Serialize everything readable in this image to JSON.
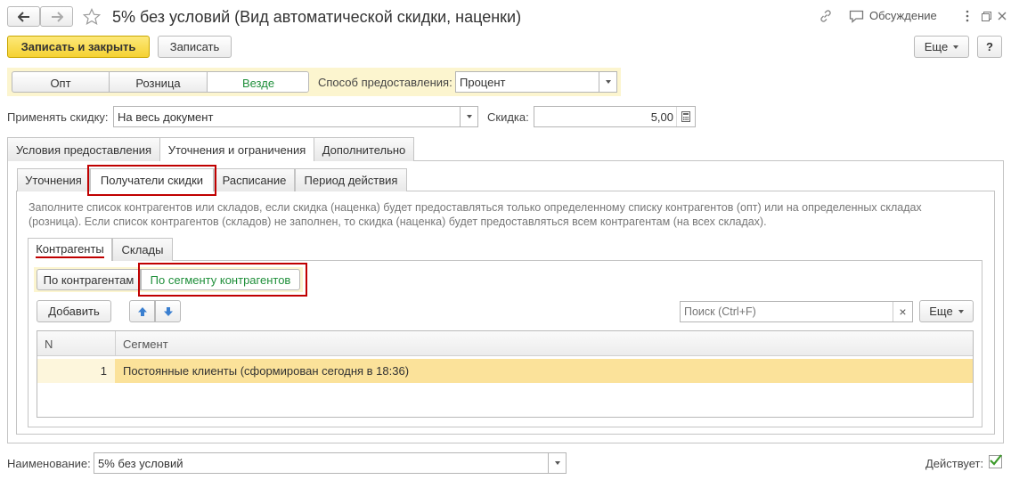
{
  "window": {
    "title": "5% без условий (Вид автоматической скидки, наценки)",
    "discussion_label": "Обсуждение"
  },
  "toolbar": {
    "save_close_label": "Записать и закрыть",
    "save_label": "Записать",
    "more_label": "Еще",
    "help_label": "?"
  },
  "scope": {
    "options": [
      "Опт",
      "Розница",
      "Везде"
    ],
    "selected": "Везде",
    "method_label": "Способ предоставления:",
    "method_value": "Процент"
  },
  "apply": {
    "label": "Применять скидку:",
    "value": "На весь документ",
    "discount_label": "Скидка:",
    "discount_value": "5,00"
  },
  "main_tabs": [
    {
      "label": "Условия предоставления",
      "active": false
    },
    {
      "label": "Уточнения и ограничения",
      "active": true
    },
    {
      "label": "Дополнительно",
      "active": false
    }
  ],
  "sub_tabs": [
    {
      "label": "Уточнения",
      "active": false
    },
    {
      "label": "Получатели скидки",
      "active": true
    },
    {
      "label": "Расписание",
      "active": false
    },
    {
      "label": "Период действия",
      "active": false
    }
  ],
  "info_text_1": "Заполните список контрагентов или складов, если скидка (наценка) будет предоставляться только определенному списку контрагентов (опт) или на определенных складах",
  "info_text_2": "(розница). Если список контрагентов (складов) не заполнен, то скидка (наценка) будет предоставляться всем контрагентам (на всех складах).",
  "inner_tabs": [
    {
      "label": "Контрагенты",
      "active": true
    },
    {
      "label": "Склады",
      "active": false
    }
  ],
  "mode": {
    "by_counterparties": "По контрагентам",
    "by_segment": "По сегменту контрагентов",
    "selected": "По сегменту контрагентов"
  },
  "list_toolbar": {
    "add_label": "Добавить",
    "search_placeholder": "Поиск (Ctrl+F)",
    "clear_symbol": "×",
    "more_label": "Еще"
  },
  "table": {
    "columns": [
      "N",
      "Сегмент"
    ],
    "rows": [
      {
        "n": "1",
        "segment": "Постоянные клиенты (сформирован сегодня в 18:36)"
      }
    ]
  },
  "footer": {
    "name_label": "Наименование:",
    "name_value": "5% без условий",
    "active_label": "Действует:",
    "active_checked": true
  },
  "colors": {
    "accent_yellow": "#f5d232",
    "row_highlight": "#fbe29a",
    "highlight_border": "#c00000",
    "selected_green": "#1f8f3a",
    "checkbox_green": "#3c9a2a",
    "arrow_blue": "#3a7fd0"
  }
}
